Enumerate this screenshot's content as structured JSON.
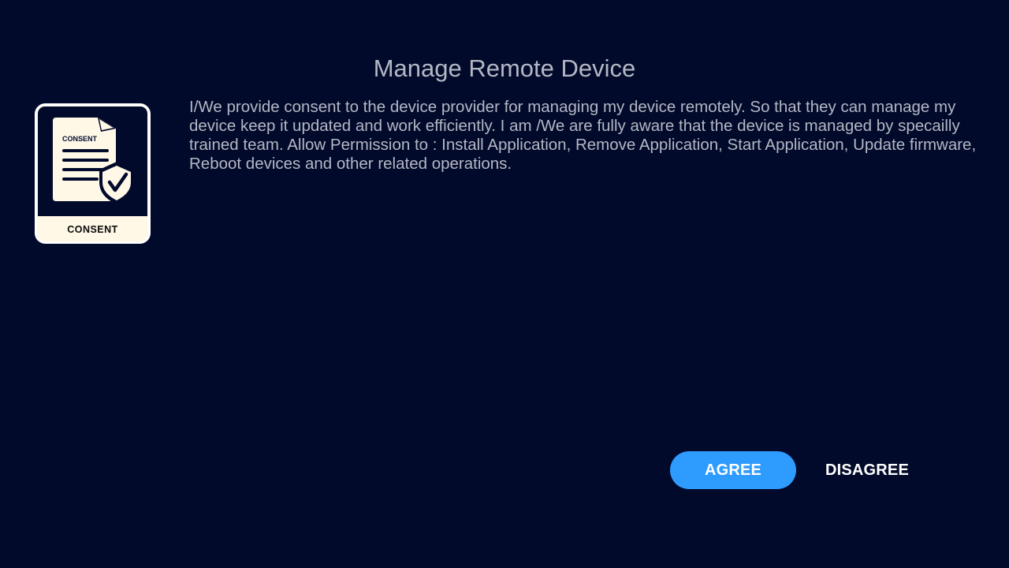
{
  "dialog": {
    "title": "Manage Remote Device",
    "message": "I/We provide consent to the device provider for managing my device remotely. So that they can manage my device keep it updated and work efficiently. I am /We are fully aware that the device is managed by specailly trained team. Allow Permission to : Install Application, Remove Application, Start Application, Update firmware, Reboot devices and other related operations."
  },
  "icon": {
    "name": "consent-document-shield-icon",
    "doc_label": "CONSENT",
    "caption": "CONSENT"
  },
  "actions": {
    "agree_label": "AGREE",
    "disagree_label": "DISAGREE"
  },
  "colors": {
    "background": "#020a2b",
    "text": "#b4b7c4",
    "accent": "#2e9bff",
    "icon_fill": "#fff8e7",
    "icon_dark": "#020a2b"
  }
}
